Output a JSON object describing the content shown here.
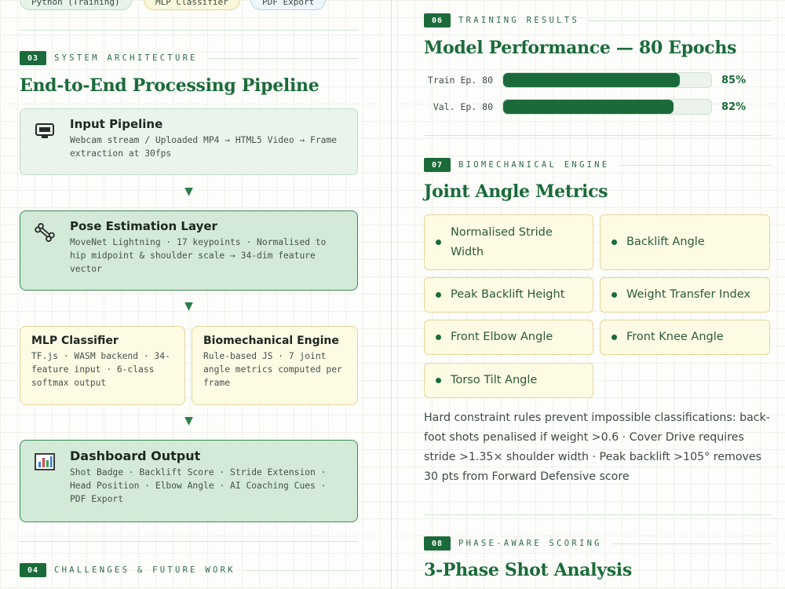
{
  "top_pills": [
    "Python (Training)",
    "MLP Classifier",
    "PDF Export"
  ],
  "left": {
    "section3": {
      "number": "03",
      "label": "SYSTEM ARCHITECTURE",
      "title": "End-to-End Processing Pipeline"
    },
    "cards": {
      "input": {
        "icon": "monitor-icon",
        "title": "Input Pipeline",
        "body": "Webcam stream / Uploaded MP4 → HTML5 Video → Frame extraction at 30fps"
      },
      "pose": {
        "icon": "bone-icon",
        "title": "Pose Estimation Layer",
        "body": "MoveNet Lightning · 17 keypoints · Normalised to hip midpoint & shoulder scale → 34-dim feature vector"
      },
      "mlp": {
        "title": "MLP Classifier",
        "body": "TF.js · WASM backend · 34-feature input · 6-class softmax output"
      },
      "bio": {
        "title": "Biomechanical Engine",
        "body": "Rule-based JS · 7 joint angle metrics computed per frame"
      },
      "dashboard": {
        "icon": "bar-chart-icon",
        "title": "Dashboard Output",
        "body": "Shot Badge · Backlift Score · Stride Extension · Head Position · Elbow Angle · AI Coaching Cues · PDF Export"
      }
    },
    "arrow": "▼",
    "section4": {
      "number": "04",
      "label": "CHALLENGES & FUTURE WORK"
    }
  },
  "right": {
    "section6": {
      "number": "06",
      "label": "TRAINING RESULTS",
      "title": "Model Performance — 80 Epochs"
    },
    "bars": [
      {
        "label": "Train Ep. 80",
        "value": 85,
        "display": "85%"
      },
      {
        "label": "Val. Ep. 80",
        "value": 82,
        "display": "82%"
      }
    ],
    "section7": {
      "number": "07",
      "label": "BIOMECHANICAL ENGINE",
      "title": "Joint Angle Metrics"
    },
    "metrics": [
      "Normalised Stride Width",
      "Backlift Angle",
      "Peak Backlift Height",
      "Weight Transfer Index",
      "Front Elbow Angle",
      "Front Knee Angle",
      "Torso Tilt Angle"
    ],
    "paragraph": "Hard constraint rules prevent impossible classifications: back-foot shots penalised if weight >0.6 · Cover Drive requires stride >1.35× shoulder width · Peak backlift >105° removes 30 pts from Forward Defensive score",
    "section8": {
      "number": "08",
      "label": "PHASE-AWARE SCORING",
      "title": "3-Phase Shot Analysis"
    }
  },
  "colors": {
    "accent": "#1b6b3a",
    "card_green": "#d3ead8",
    "card_yellow": "#fdfbe4"
  }
}
